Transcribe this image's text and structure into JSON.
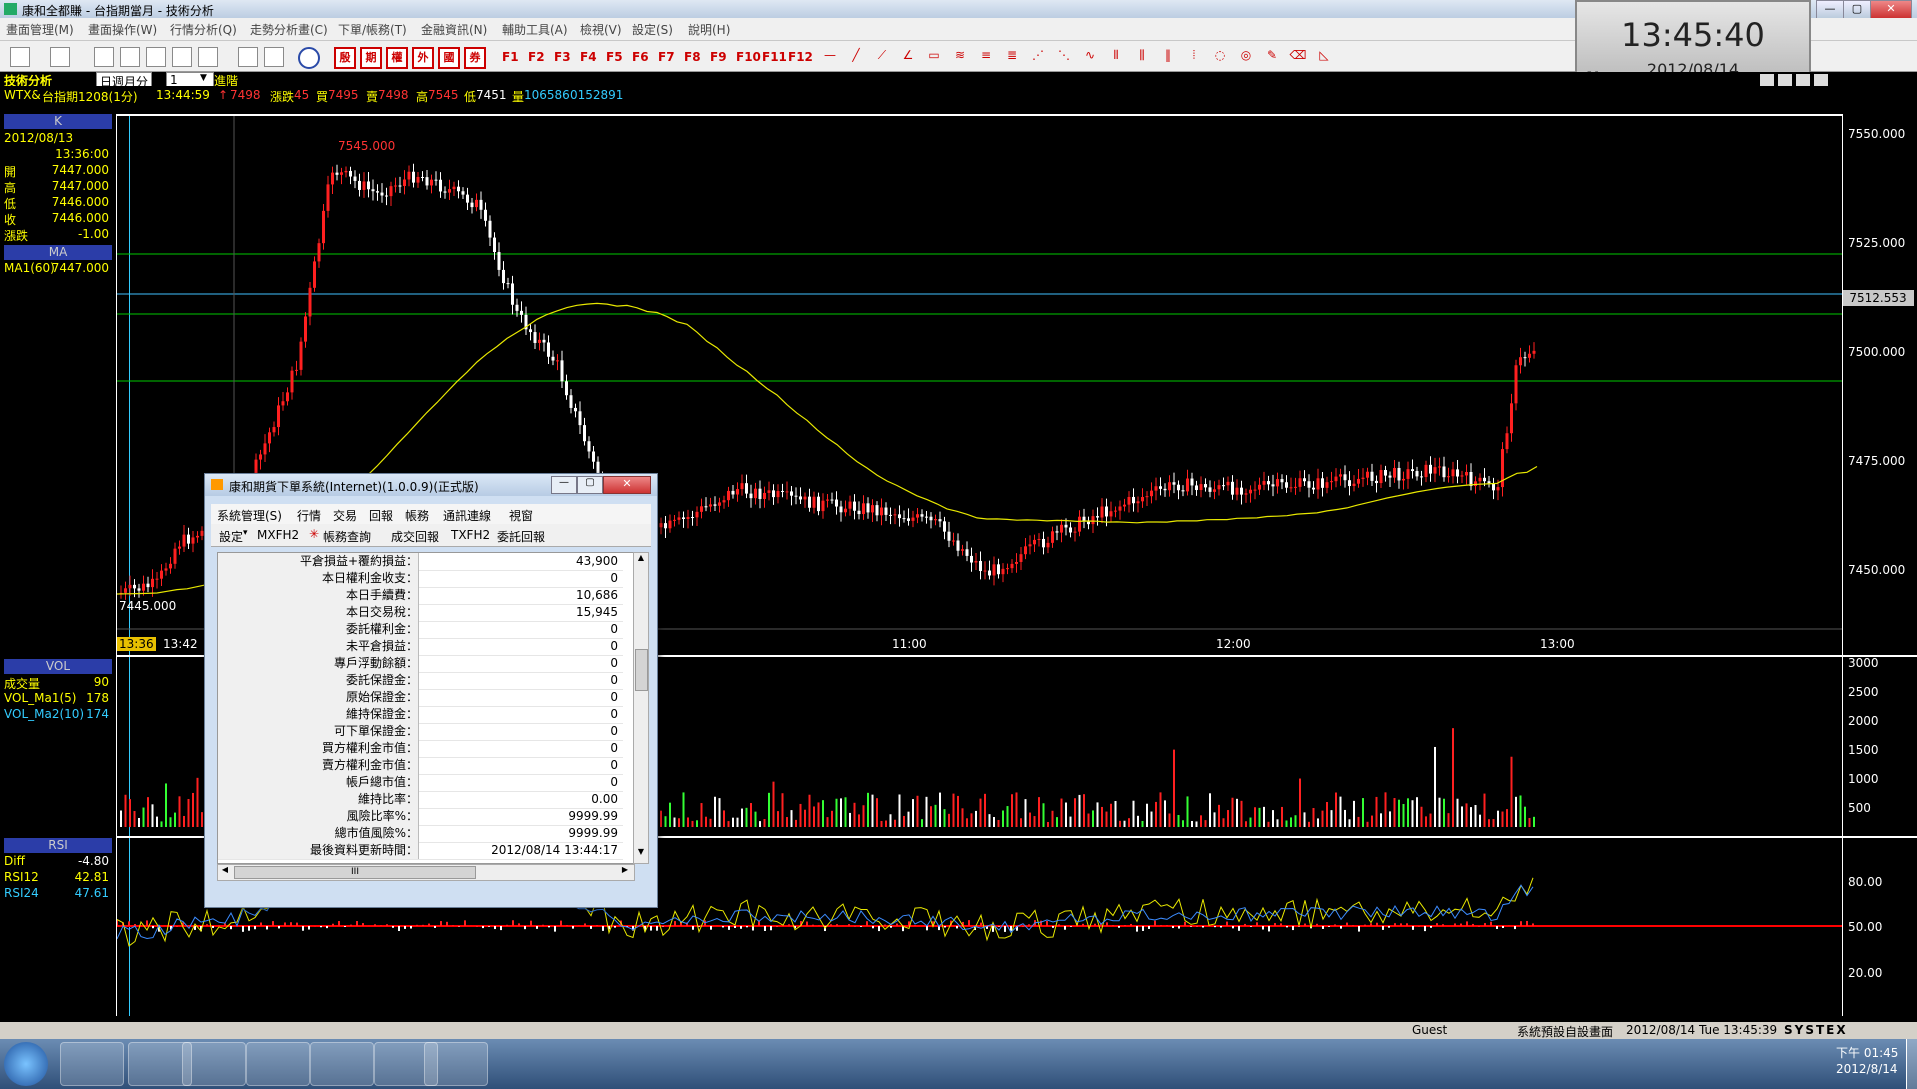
{
  "app_title": "康和全都賺 - 台指期當月 - 技術分析",
  "menu": [
    "畫面管理(M)",
    "畫面操作(W)",
    "行情分析(Q)",
    "走勢分析畫(C)",
    "下單/帳務(T)",
    "金融資訊(N)",
    "輔助工具(A)",
    "檢視(V)",
    "設定(S)",
    "說明(H)"
  ],
  "toolbar": {
    "red_buttons": [
      "殷",
      "期",
      "權",
      "外",
      "國",
      "券"
    ],
    "function_keys": [
      "F1",
      "F2",
      "F3",
      "F4",
      "F5",
      "F6",
      "F7",
      "F8",
      "F9",
      "F10",
      "F11",
      "F12"
    ]
  },
  "clock": {
    "time": "13:45:40",
    "date": "2012/08/14",
    "badge": "N"
  },
  "info_bar": {
    "section": "技術分析",
    "period_select": "日週月分",
    "period_value": "1",
    "apply_button": "進階",
    "symbol": "WTX&",
    "contract": "台指期1208(1分)",
    "time": "13:44:59",
    "last": "7498",
    "change_label": "漲跌",
    "change": "45",
    "bid_label": "買",
    "bid": "7495",
    "ask_label": "賣",
    "ask": "7498",
    "high_label": "高",
    "high": "7545",
    "low_label": "低",
    "low": "7451",
    "vol_label": "量",
    "vol": "106586",
    "extra": "0152891"
  },
  "left_panel": {
    "k_header": "K",
    "date": "2012/08/13",
    "time": "13:36:00",
    "ohlc": [
      {
        "label": "開",
        "value": "7447.000"
      },
      {
        "label": "高",
        "value": "7447.000"
      },
      {
        "label": "低",
        "value": "7446.000"
      },
      {
        "label": "收",
        "value": "7446.000"
      },
      {
        "label": "漲跌",
        "value": "-1.00"
      }
    ],
    "ma_header": "MA",
    "ma_label": "MA1(60)",
    "ma_value": "7447.000",
    "vol_header": "VOL",
    "vol_rows": [
      {
        "label": "成交量",
        "value": "90"
      },
      {
        "label": "VOL_Ma1(5)",
        "value": "178"
      },
      {
        "label": "VOL_Ma2(10)",
        "value": "174"
      }
    ],
    "rsi_header": "RSI",
    "rsi_rows": [
      {
        "label": "Diff",
        "value": "-4.80"
      },
      {
        "label": "RSI12",
        "value": "42.81"
      },
      {
        "label": "RSI24",
        "value": "47.61"
      }
    ]
  },
  "price_pane": {
    "y_ticks": [
      "7550.000",
      "7525.000",
      "7500.000",
      "7475.000",
      "7450.000"
    ],
    "current_price_tag": "7512.553",
    "high_annotation": "7545.000",
    "low_annotation": "7445.000",
    "x_ticks": [
      "13:36",
      "13:42",
      "11:00",
      "12:00",
      "13:00"
    ],
    "colors": {
      "up": "#ff2020",
      "down": "#ffffff",
      "ma": "#e8e800",
      "grid": "#00c800",
      "current": "#40c0ff"
    }
  },
  "vol_pane": {
    "y_ticks": [
      "3000",
      "2500",
      "2000",
      "1500",
      "1000",
      "500"
    ]
  },
  "rsi_pane": {
    "y_ticks": [
      "80.00",
      "50.00",
      "20.00"
    ]
  },
  "dialog": {
    "title": "康和期貨下單系統(Internet)(1.0.0.9)(正式版)",
    "menu": [
      "系統管理(S)",
      "行情",
      "交易",
      "回報",
      "帳務",
      "通訊連線",
      "視窗"
    ],
    "tools": [
      "設定",
      "MXFH2",
      "帳務查詢",
      "成交回報",
      "TXFH2",
      "委託回報"
    ],
    "rows": [
      {
        "k": "平倉損益+覆約損益：",
        "v": "43,900"
      },
      {
        "k": "本日權利金收支：",
        "v": "0"
      },
      {
        "k": "本日手續費：",
        "v": "10,686"
      },
      {
        "k": "本日交易稅：",
        "v": "15,945"
      },
      {
        "k": "委託權利金：",
        "v": "0"
      },
      {
        "k": "未平倉損益：",
        "v": "0"
      },
      {
        "k": "專戶浮動餘額：",
        "v": "0"
      },
      {
        "k": "委託保證金：",
        "v": "0"
      },
      {
        "k": "原始保證金：",
        "v": "0"
      },
      {
        "k": "維持保證金：",
        "v": "0"
      },
      {
        "k": "可下單保證金：",
        "v": "0"
      },
      {
        "k": "買方權利金市值：",
        "v": "0"
      },
      {
        "k": "賣方權利金市值：",
        "v": "0"
      },
      {
        "k": "帳戶總市值：",
        "v": "0"
      },
      {
        "k": "維持比率：",
        "v": "0.00"
      },
      {
        "k": "風險比率%：",
        "v": "9999.99"
      },
      {
        "k": "總市值風險%：",
        "v": "9999.99"
      },
      {
        "k": "最後資料更新時間：",
        "v": "2012/08/14 13:44:17"
      }
    ],
    "hscroll_label": "III"
  },
  "status_bar": {
    "user": "Guest",
    "layout": "系統預設自設畫面",
    "datetime": "2012/08/14 Tue 13:45:39",
    "brand": "SYSTEX"
  },
  "taskbar": {
    "time": "下午 01:45",
    "date": "2012/8/14",
    "apps": [
      "windows-explorer",
      "notes",
      "internet-explorer",
      "trading-lightning",
      "concord-app",
      "excel",
      "lightning-app"
    ]
  }
}
